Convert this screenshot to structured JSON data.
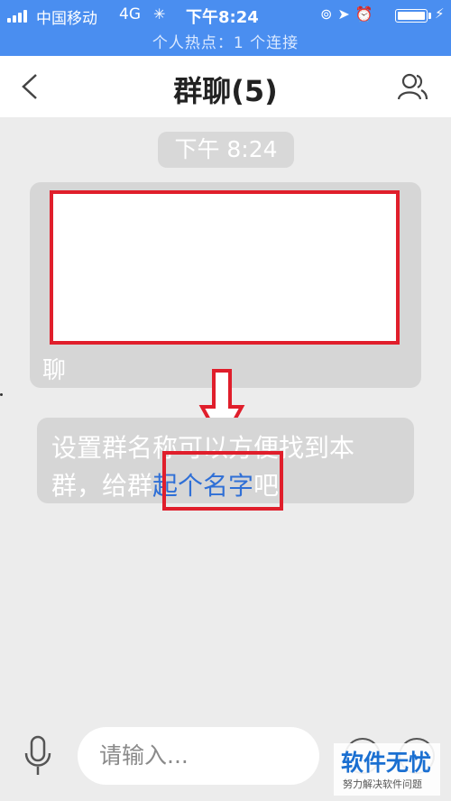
{
  "status_bar": {
    "carrier": "中国移动",
    "network": "4G",
    "time": "下午8:24",
    "hotspot": "个人热点：1 个连接"
  },
  "nav": {
    "title": "群聊(5)"
  },
  "chat": {
    "time_label": "下午 8:24",
    "message1_tail": "聊",
    "message2": {
      "line1": "设置群名称可以方便找到本",
      "line2_prefix": "群，给群",
      "line2_link": "起个名字",
      "line2_suffix": "吧"
    }
  },
  "input_bar": {
    "placeholder": "请输入..."
  },
  "watermark": {
    "title": "软件无忧",
    "subtitle": "努力解决软件问题"
  },
  "colors": {
    "status_bar": "#4a8ef0",
    "highlight": "#e01e2b",
    "link": "#2f6fd6"
  }
}
